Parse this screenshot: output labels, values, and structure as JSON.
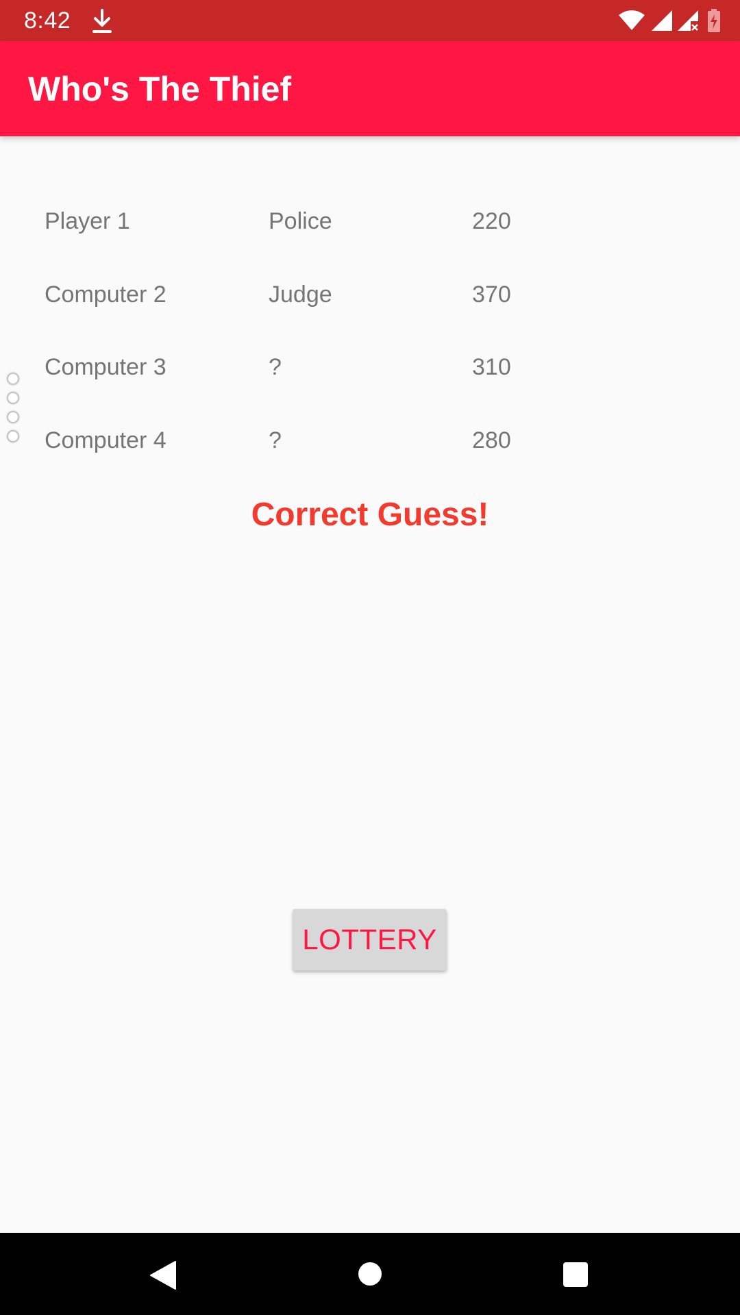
{
  "status_bar": {
    "time": "8:42",
    "icons": [
      "download-icon",
      "wifi-icon",
      "signal-icon",
      "signal-no-data-icon",
      "battery-charging-icon"
    ]
  },
  "app_bar": {
    "title": "Who's The Thief",
    "color": "#ff1744"
  },
  "players": [
    {
      "name": "Player 1",
      "role": "Police",
      "score": "220"
    },
    {
      "name": "Computer 2",
      "role": "Judge",
      "score": "370"
    },
    {
      "name": "Computer 3",
      "role": "?",
      "score": "310"
    },
    {
      "name": "Computer 4",
      "role": "?",
      "score": "280"
    }
  ],
  "result": {
    "message": "Correct Guess!",
    "color": "#f4392d"
  },
  "lottery_button": {
    "label": "LOTTERY"
  },
  "nav_bar": {
    "icons": [
      "back-icon",
      "home-icon",
      "recents-icon"
    ]
  }
}
